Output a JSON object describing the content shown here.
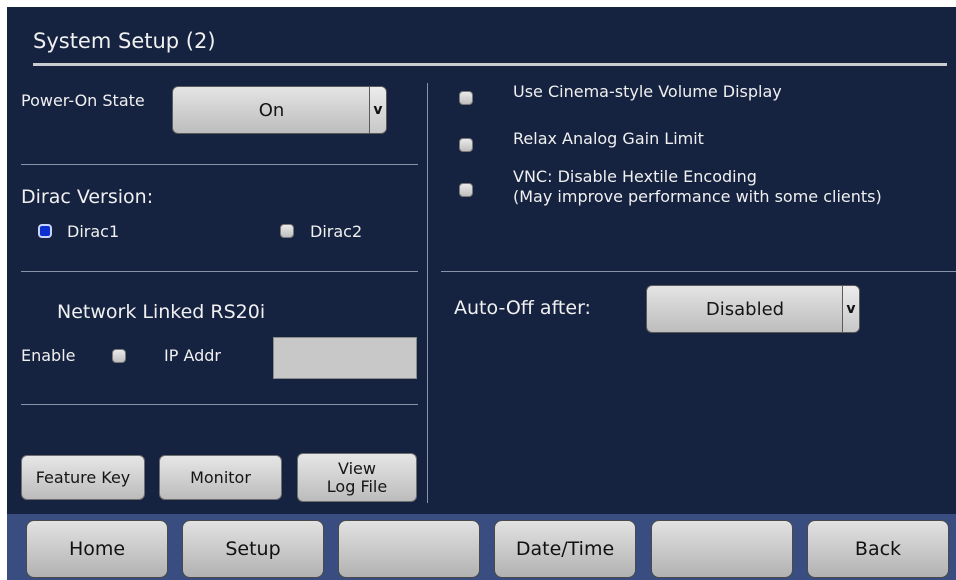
{
  "title": "System Setup (2)",
  "power_on": {
    "label": "Power-On State",
    "value": "On",
    "arrow": "v"
  },
  "dirac": {
    "label": "Dirac Version:",
    "options": [
      {
        "label": "Dirac1",
        "checked": true
      },
      {
        "label": "Dirac2",
        "checked": false
      }
    ]
  },
  "network": {
    "heading": "Network Linked RS20i",
    "enable_label": "Enable",
    "enable_checked": false,
    "ip_label": "IP Addr",
    "ip_value": ""
  },
  "left_buttons": {
    "feature_key": "Feature Key",
    "monitor": "Monitor",
    "view_log": "View\nLog File"
  },
  "options": [
    {
      "label": "Use Cinema-style Volume Display",
      "checked": false
    },
    {
      "label": "Relax Analog Gain Limit",
      "checked": false
    },
    {
      "label": "VNC: Disable Hextile Encoding\n(May improve performance with some clients)",
      "checked": false
    }
  ],
  "auto_off": {
    "label": "Auto-Off after:",
    "value": "Disabled",
    "arrow": "v"
  },
  "nav": {
    "home": "Home",
    "setup": "Setup",
    "blank1": "",
    "datetime": "Date/Time",
    "blank2": "",
    "back": "Back"
  },
  "colors": {
    "background": "#152240",
    "bottom_bar": "#3a4d80",
    "checkbox_on": "#0c2fcf"
  }
}
